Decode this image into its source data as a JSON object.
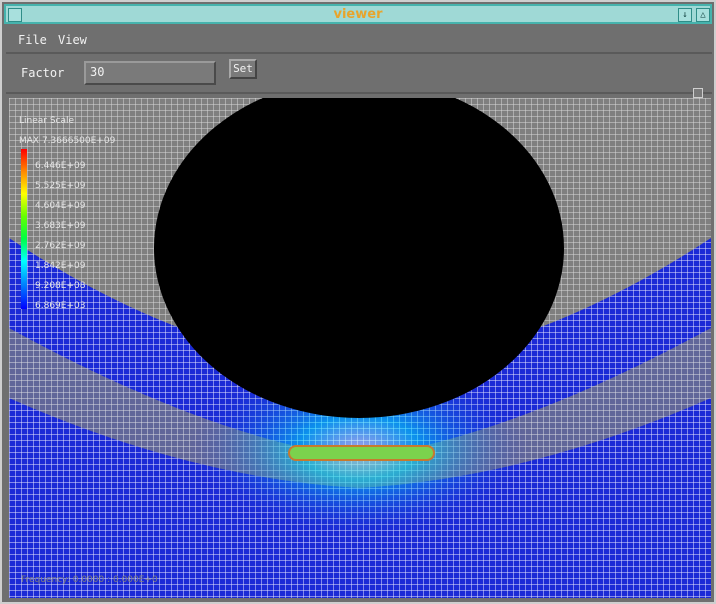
{
  "window": {
    "title": "viewer",
    "left_button": "",
    "btn_a": "↓",
    "btn_b": "△"
  },
  "menu": {
    "items": [
      "File",
      "View"
    ]
  },
  "toolbar": {
    "factor_label": "Factor",
    "factor_value": "30",
    "set_label": "Set"
  },
  "legend": {
    "title": "Linear Scale",
    "max": "MAX  7.3666500E+09",
    "labels": [
      "6.446E+09",
      "5.525E+09",
      "4.604E+09",
      "3.683E+09",
      "2.762E+09",
      "1.842E+09",
      "9.208E+08",
      "6.869E+03"
    ]
  },
  "footer": {
    "text": "Frequency: 0.0000 : 0.000E+0"
  },
  "colors": {
    "mesh_gray": "#9a9a9a",
    "mesh_blue": "#1b2ad6",
    "highlight_green": "#66cc44",
    "hole_black": "#000000"
  }
}
